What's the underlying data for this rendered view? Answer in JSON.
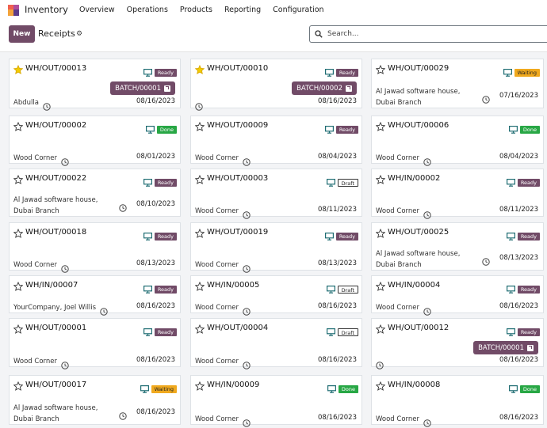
{
  "topnav": {
    "app_name": "Inventory",
    "items": [
      "Overview",
      "Operations",
      "Products",
      "Reporting",
      "Configuration"
    ]
  },
  "control": {
    "new_label": "New",
    "title": "Receipts",
    "search_placeholder": "Search..."
  },
  "colors": {
    "brand": "#714b67",
    "done": "#28a745",
    "waiting": "#f0a91e"
  },
  "cards": [
    {
      "ref": "WH/OUT/00013",
      "starred": true,
      "state": "Ready",
      "batch": "BATCH/00001",
      "partner": [
        "Abdulla"
      ],
      "date": "08/16/2023"
    },
    {
      "ref": "WH/OUT/00010",
      "starred": true,
      "state": "Ready",
      "batch": "BATCH/00002",
      "partner": [],
      "date": "08/16/2023"
    },
    {
      "ref": "WH/OUT/00029",
      "starred": false,
      "state": "Waiting",
      "batch": "",
      "partner": [
        "Al Jawad software house,",
        "Dubai Branch"
      ],
      "date": "07/16/2023"
    },
    {
      "ref": "WH/OUT/00002",
      "starred": false,
      "state": "Done",
      "batch": "",
      "partner": [
        "Wood Corner"
      ],
      "date": "08/01/2023"
    },
    {
      "ref": "WH/OUT/00009",
      "starred": false,
      "state": "Ready",
      "batch": "",
      "partner": [
        "Wood Corner"
      ],
      "date": "08/04/2023"
    },
    {
      "ref": "WH/OUT/00006",
      "starred": false,
      "state": "Done",
      "batch": "",
      "partner": [
        "Wood Corner"
      ],
      "date": "08/04/2023"
    },
    {
      "ref": "WH/OUT/00022",
      "starred": false,
      "state": "Ready",
      "batch": "",
      "partner": [
        "Al Jawad software house,",
        "Dubai Branch"
      ],
      "date": "08/10/2023"
    },
    {
      "ref": "WH/OUT/00003",
      "starred": false,
      "state": "Draft",
      "batch": "",
      "partner": [
        "Wood Corner"
      ],
      "date": "08/11/2023"
    },
    {
      "ref": "WH/IN/00002",
      "starred": false,
      "state": "Ready",
      "batch": "",
      "partner": [
        "Wood Corner"
      ],
      "date": "08/11/2023"
    },
    {
      "ref": "WH/OUT/00018",
      "starred": false,
      "state": "Ready",
      "batch": "",
      "partner": [
        "Wood Corner"
      ],
      "date": "08/13/2023"
    },
    {
      "ref": "WH/OUT/00019",
      "starred": false,
      "state": "Ready",
      "batch": "",
      "partner": [
        "Wood Corner"
      ],
      "date": "08/13/2023"
    },
    {
      "ref": "WH/OUT/00025",
      "starred": false,
      "state": "Ready",
      "batch": "",
      "partner": [
        "Al Jawad software house,",
        "Dubai Branch"
      ],
      "date": "08/13/2023"
    },
    {
      "ref": "WH/IN/00007",
      "starred": false,
      "state": "Ready",
      "batch": "",
      "partner": [
        "YourCompany, Joel Willis"
      ],
      "date": "08/16/2023"
    },
    {
      "ref": "WH/IN/00005",
      "starred": false,
      "state": "Draft",
      "batch": "",
      "partner": [
        "Wood Corner"
      ],
      "date": "08/16/2023"
    },
    {
      "ref": "WH/IN/00004",
      "starred": false,
      "state": "Ready",
      "batch": "",
      "partner": [
        "Wood Corner"
      ],
      "date": "08/16/2023"
    },
    {
      "ref": "WH/OUT/00001",
      "starred": false,
      "state": "Ready",
      "batch": "",
      "partner": [
        "Wood Corner"
      ],
      "date": "08/16/2023"
    },
    {
      "ref": "WH/OUT/00004",
      "starred": false,
      "state": "Draft",
      "batch": "",
      "partner": [
        "Wood Corner"
      ],
      "date": "08/16/2023"
    },
    {
      "ref": "WH/OUT/00012",
      "starred": false,
      "state": "Ready",
      "batch": "BATCH/00001",
      "partner": [],
      "date": "08/16/2023"
    },
    {
      "ref": "WH/OUT/00017",
      "starred": false,
      "state": "Waiting",
      "batch": "",
      "partner": [
        "Al Jawad software house,",
        "Dubai Branch"
      ],
      "date": "08/16/2023"
    },
    {
      "ref": "WH/IN/00009",
      "starred": false,
      "state": "Done",
      "batch": "",
      "partner": [
        "Wood Corner"
      ],
      "date": "08/16/2023"
    },
    {
      "ref": "WH/IN/00008",
      "starred": false,
      "state": "Done",
      "batch": "",
      "partner": [
        "Wood Corner"
      ],
      "date": "08/16/2023"
    }
  ]
}
